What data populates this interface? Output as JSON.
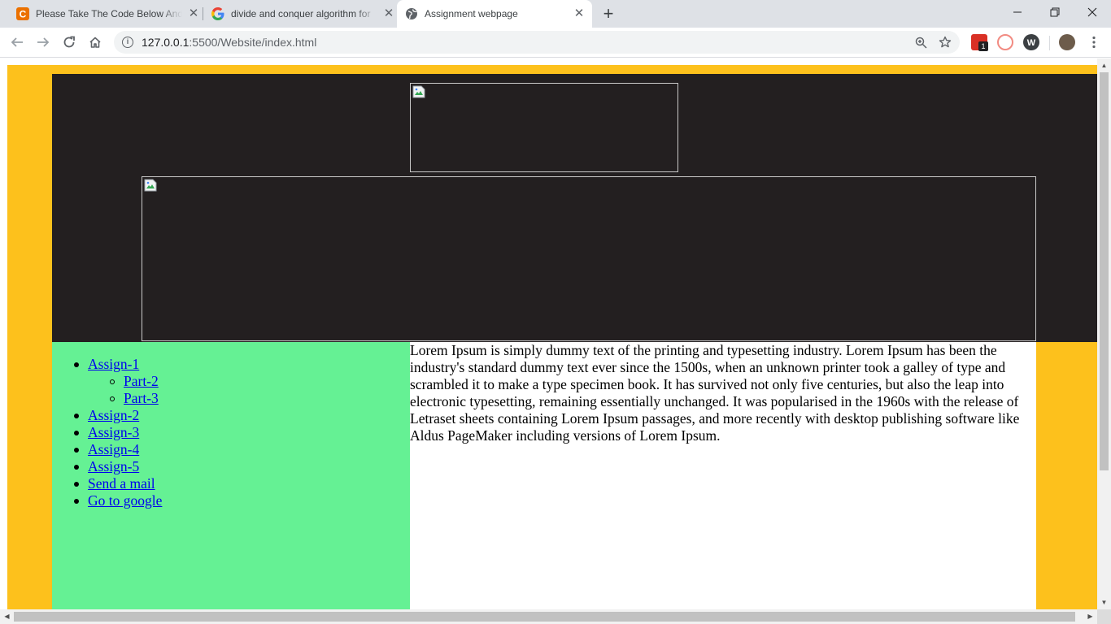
{
  "browser": {
    "tabs": [
      {
        "title": "Please Take The Code Below And",
        "favicon": "chegg-icon",
        "active": false
      },
      {
        "title": "divide and conquer algorithm for",
        "favicon": "google-icon",
        "active": false
      },
      {
        "title": "Assignment webpage",
        "favicon": "globe-icon",
        "active": true
      }
    ],
    "new_tab_label": "+",
    "address": {
      "host": "127.0.0.1",
      "path": ":5500/Website/index.html"
    },
    "extension_badge": "1"
  },
  "page": {
    "logo_image": {
      "alt": "",
      "state": "broken"
    },
    "banner_image": {
      "alt": "",
      "state": "broken"
    },
    "nav": {
      "items": [
        {
          "label": "Assign-1",
          "children": [
            {
              "label": "Part-2"
            },
            {
              "label": "Part-3"
            }
          ]
        },
        {
          "label": "Assign-2"
        },
        {
          "label": "Assign-3"
        },
        {
          "label": "Assign-4"
        },
        {
          "label": "Assign-5"
        },
        {
          "label": "Send a mail"
        },
        {
          "label": "Go to google"
        }
      ]
    },
    "content": {
      "text": "Lorem Ipsum is simply dummy text of the printing and typesetting industry. Lorem Ipsum has been the industry's standard dummy text ever since the 1500s, when an unknown printer took a galley of type and scrambled it to make a type specimen book. It has survived not only five centuries, but also the leap into electronic typesetting, remaining essentially unchanged. It was popularised in the 1960s with the release of Letraset sheets containing Lorem Ipsum passages, and more recently with desktop publishing software like Aldus PageMaker including versions of Lorem Ipsum."
    },
    "colors": {
      "frame": "#fdc11c",
      "header": "#231f20",
      "sidebar": "#65f194",
      "content": "#ffffff",
      "link": "#0000ee"
    }
  }
}
